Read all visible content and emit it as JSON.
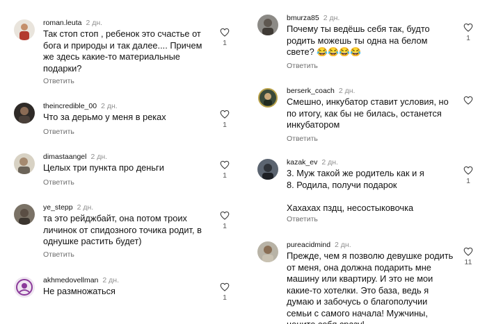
{
  "reply_label": "Ответить",
  "left": [
    {
      "user": "roman.leuta",
      "time": "2 дн.",
      "text": "Так стоп стоп , ребенок это счастье от бога и природы и так далее.... Причем же здесь какие-то материальные подарки?",
      "likes": "1",
      "avatar": "avatar-icon"
    },
    {
      "user": "theincredible_00",
      "time": "2 дн.",
      "text": "Что за дерьмо у меня в реках",
      "likes": "1",
      "avatar": "avatar-icon"
    },
    {
      "user": "dimastaangel",
      "time": "2 дн.",
      "text": "Целых три пункта про деньги",
      "likes": "1",
      "avatar": "avatar-icon"
    },
    {
      "user": "ye_stepp",
      "time": "2 дн.",
      "text": "та это рейджбайт, она потом троих личинок от спидозного точика родит, в однушке растить будет)",
      "likes": "1",
      "avatar": "avatar-icon"
    },
    {
      "user": "akhmedovellman",
      "time": "2 дн.",
      "text": "Не размножаться",
      "likes": "1",
      "avatar": "avatar-icon"
    }
  ],
  "right": [
    {
      "user": "bmurza85",
      "time": "2 дн.",
      "text": "Почему ты ведёшь себя так, будто родить можешь ты одна на белом свете? 😂😂😂😂",
      "likes": "1",
      "avatar": "avatar-icon"
    },
    {
      "user": "berserk_coach",
      "time": "2 дн.",
      "text": "Смешно, инкубатор ставит условия, но по итогу, как бы не билась, останется инкубатором",
      "likes": "",
      "avatar": "avatar-icon"
    },
    {
      "user": "kazak_ev",
      "time": "2 дн.",
      "text_lines": [
        "3. Муж такой же родитель как и я",
        "8. Родила, получи подарок",
        "",
        "Хахахах пздц, несостыковочка"
      ],
      "likes": "1",
      "avatar": "avatar-icon"
    },
    {
      "user": "pureacidmind",
      "time": "2 дн.",
      "text": "Прежде, чем я позволю девушке родить от меня, она должна подарить мне машину или квартиру. И это не мои какие-то хотелки. Это база, ведь я думаю и забочусь о благополучии семьи с самого начала! Мужчины, цените себя сразу!",
      "likes": "11",
      "avatar": "avatar-icon"
    }
  ],
  "colors": {
    "text": "#111111",
    "meta": "#8e8e8e",
    "reply": "#6e6e6e",
    "background": "#ffffff"
  }
}
